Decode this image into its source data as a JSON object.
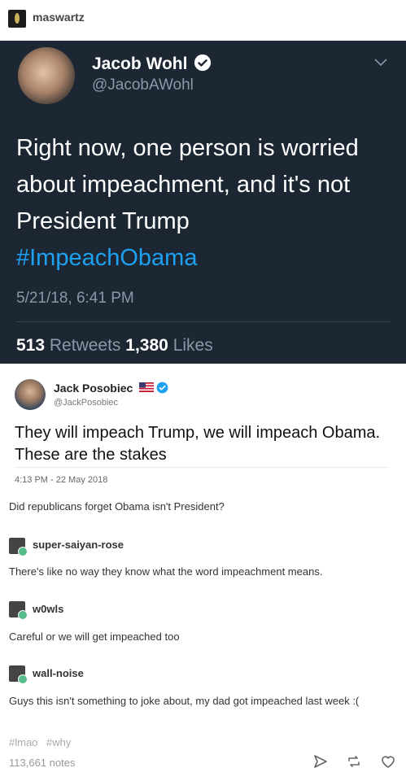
{
  "post": {
    "username": "maswartz"
  },
  "embedded_tweet_1": {
    "name": "Jacob Wohl",
    "handle": "@JacobAWohl",
    "text_main": "Right now, one person is worried about impeachment, and it's not President Trump",
    "hashtag": "#ImpeachObama",
    "date": "5/21/18, 6:41 PM",
    "retweets_count": "513",
    "retweets_label": "Retweets",
    "likes_count": "1,380",
    "likes_label": "Likes"
  },
  "embedded_tweet_2": {
    "name": "Jack Posobiec",
    "handle": "@JackPosobiec",
    "text": "They will impeach Trump, we will impeach Obama. These are the stakes",
    "date": "4:13 PM - 22 May 2018"
  },
  "op_comment": "Did republicans forget Obama isn't President?",
  "reblogs": [
    {
      "username": "super-saiyan-rose",
      "text": "There's like no way they know what the word impeachment means."
    },
    {
      "username": "w0wls",
      "text": "Careful or we will get impeached too"
    },
    {
      "username": "wall-noise",
      "text": "Guys this isn't something to joke about, my dad got impeached last week :("
    }
  ],
  "tags": [
    "#lmao",
    "#why"
  ],
  "notes": "113,661 notes",
  "icons": {
    "verified": "verified-badge-icon",
    "chevron": "chevron-down-icon",
    "flag": "us-flag-icon",
    "share": "share-icon",
    "reblog": "reblog-icon",
    "like": "heart-icon"
  },
  "colors": {
    "tweet_dark_bg": "#1c2733",
    "twitter_blue": "#1da1f2",
    "muted_text": "#8899a6"
  }
}
